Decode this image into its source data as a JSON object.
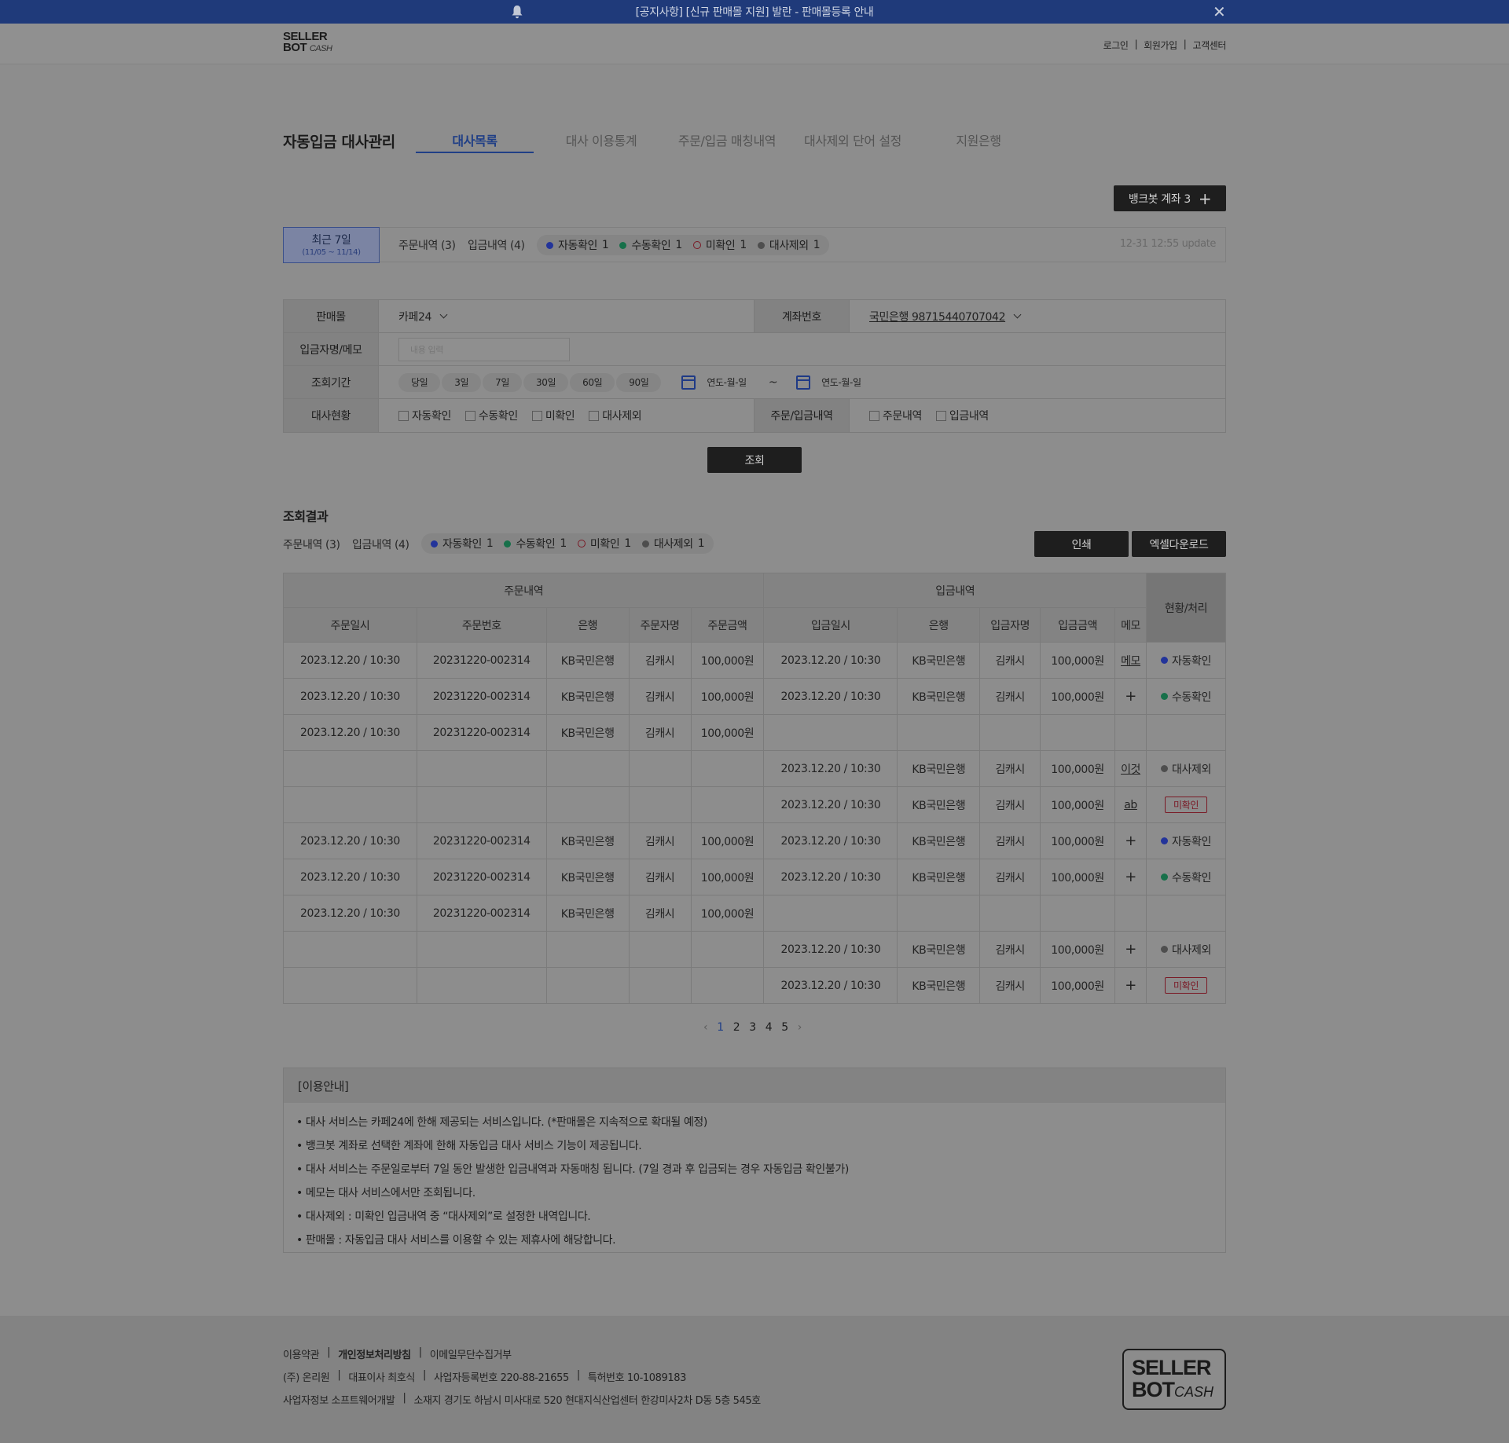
{
  "notice": {
    "text": "[공지사항] [신규 판매몰 지원] 발란 - 판매몰등록 안내"
  },
  "logo": {
    "line1": "SELLER",
    "line2": "BOT",
    "line3": "CASH"
  },
  "topnav": {
    "login": "로그인",
    "signup": "회원가입",
    "support": "고객센터"
  },
  "page_title": "자동입금 대사관리",
  "tabs": [
    "대사목록",
    "대사 이용통계",
    "주문/입금 매칭내역",
    "대사제외 단어 설정",
    "지원은행"
  ],
  "bankbot_button": "뱅크봇 계좌 3",
  "summary": {
    "range_label": "최근 7일",
    "range_dates": "(11/05 ~ 11/14)",
    "orders": "주문내역 (3)",
    "deposits": "입금내역 (4)",
    "statuses": [
      {
        "label": "자동확인",
        "count": "1",
        "color": "#23349a"
      },
      {
        "label": "수동확인",
        "count": "1",
        "color": "#17704a"
      },
      {
        "label": "미확인",
        "count": "1",
        "color": "#7a1a26"
      },
      {
        "label": "대사제외",
        "count": "1",
        "color": "#4e4e4e"
      }
    ],
    "update": "12-31 12:55 update"
  },
  "filters": {
    "mall_label": "판매몰",
    "mall_value": "카페24",
    "account_label": "계좌번호",
    "account_value": "국민은행 98715440707042",
    "depositor_label": "입금자명/메모",
    "depositor_placeholder": "내용 입력",
    "period_label": "조회기간",
    "period_buttons": [
      "당일",
      "3일",
      "7일",
      "30일",
      "60일",
      "90일"
    ],
    "date_placeholder": "연도-월-일",
    "date_sep": "~",
    "status_label": "대사현황",
    "status_options": [
      "자동확인",
      "수동확인",
      "미확인",
      "대사제외"
    ],
    "type_label": "주문/입금내역",
    "type_options": [
      "주문내역",
      "입금내역"
    ]
  },
  "search_button": "조회",
  "results": {
    "title": "조회결과",
    "orders": "주문내역 (3)",
    "deposits": "입금내역 (4)",
    "print_button": "인쇄",
    "excel_button": "엑셀다운로드",
    "group_orders": "주문내역",
    "group_deposits": "입금내역",
    "status_header": "현황/처리",
    "columns": [
      "주문일시",
      "주문번호",
      "은행",
      "주문자명",
      "주문금액",
      "입금일시",
      "은행",
      "입금자명",
      "입금금액",
      "메모"
    ],
    "rows": [
      {
        "cells": [
          "2023.12.20 / 10:30",
          "20231220-002314",
          "KB국민은행",
          "김캐시",
          "100,000원",
          "2023.12.20 / 10:30",
          "KB국민은행",
          "김캐시",
          "100,000원"
        ],
        "memo": "메모",
        "status": "자동확인",
        "kind": "blue"
      },
      {
        "cells": [
          "2023.12.20 / 10:30",
          "20231220-002314",
          "KB국민은행",
          "김캐시",
          "100,000원",
          "2023.12.20 / 10:30",
          "KB국민은행",
          "김캐시",
          "100,000원"
        ],
        "memo": "+",
        "status": "수동확인",
        "kind": "green"
      },
      {
        "cells": [
          "2023.12.20 / 10:30",
          "20231220-002314",
          "KB국민은행",
          "김캐시",
          "100,000원",
          "",
          "",
          "",
          ""
        ],
        "memo": "",
        "status": "",
        "kind": ""
      },
      {
        "cells": [
          "",
          "",
          "",
          "",
          "",
          "2023.12.20 / 10:30",
          "KB국민은행",
          "김캐시",
          "100,000원"
        ],
        "memo": "이것",
        "status": "대사제외",
        "kind": "gray"
      },
      {
        "cells": [
          "",
          "",
          "",
          "",
          "",
          "2023.12.20 / 10:30",
          "KB국민은행",
          "김캐시",
          "100,000원"
        ],
        "memo": "ab",
        "status": "미확인",
        "kind": "unconf"
      },
      {
        "cells": [
          "2023.12.20 / 10:30",
          "20231220-002314",
          "KB국민은행",
          "김캐시",
          "100,000원",
          "2023.12.20 / 10:30",
          "KB국민은행",
          "김캐시",
          "100,000원"
        ],
        "memo": "+",
        "status": "자동확인",
        "kind": "blue"
      },
      {
        "cells": [
          "2023.12.20 / 10:30",
          "20231220-002314",
          "KB국민은행",
          "김캐시",
          "100,000원",
          "2023.12.20 / 10:30",
          "KB국민은행",
          "김캐시",
          "100,000원"
        ],
        "memo": "+",
        "status": "수동확인",
        "kind": "green"
      },
      {
        "cells": [
          "2023.12.20 / 10:30",
          "20231220-002314",
          "KB국민은행",
          "김캐시",
          "100,000원",
          "",
          "",
          "",
          ""
        ],
        "memo": "",
        "status": "",
        "kind": ""
      },
      {
        "cells": [
          "",
          "",
          "",
          "",
          "",
          "2023.12.20 / 10:30",
          "KB국민은행",
          "김캐시",
          "100,000원"
        ],
        "memo": "+",
        "status": "대사제외",
        "kind": "gray"
      },
      {
        "cells": [
          "",
          "",
          "",
          "",
          "",
          "2023.12.20 / 10:30",
          "KB국민은행",
          "김캐시",
          "100,000원"
        ],
        "memo": "+",
        "status": "미확인",
        "kind": "unconf"
      }
    ]
  },
  "pagination": {
    "pages": [
      "1",
      "2",
      "3",
      "4",
      "5"
    ],
    "current": "1"
  },
  "info": {
    "title": "[이용안내]",
    "items": [
      "대사 서비스는 카페24에 한해 제공되는 서비스입니다. (*판매몰은 지속적으로 확대될 예정)",
      "뱅크봇 계좌로 선택한 계좌에 한해 자동입금 대사 서비스 기능이 제공됩니다.",
      "대사 서비스는 주문일로부터 7일 동안 발생한 입금내역과 자동매칭 됩니다. (7일 경과 후 입금되는 경우 자동입금 확인불가)",
      "메모는 대사 서비스에서만 조회됩니다.",
      "대사제외 : 미확인 입금내역 중 “대사제외”로 설정한 내역입니다.",
      "판매몰 : 자동입금 대사 서비스를 이용할 수 있는 제휴사에 해당합니다."
    ]
  },
  "footer": {
    "terms": "이용약관",
    "privacy": "개인정보처리방침",
    "email": "이메일무단수집거부",
    "company": "(주) 온리원",
    "ceo": "대표이사 최호식",
    "bizno": "사업자등록번호 220-88-21655",
    "patent": "특허번호 10-1089183",
    "dept": "사업자정보 소프트웨어개발",
    "address": "소재지 경기도 하남시 미사대로 520 현대지식산업센터 한강미사2차 D동 5층 545호"
  }
}
